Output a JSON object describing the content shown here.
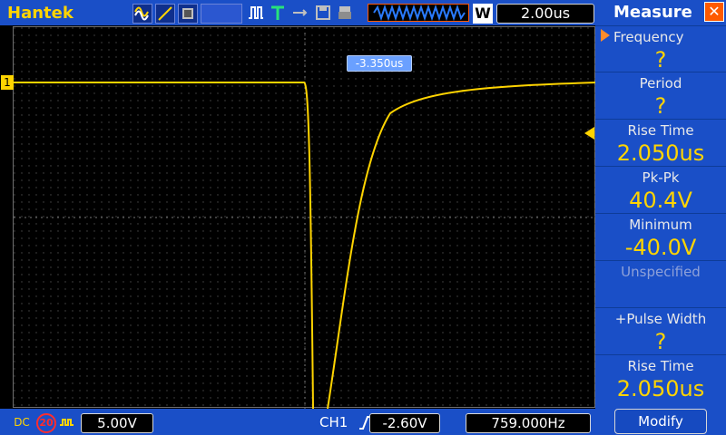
{
  "header": {
    "brand": "Hantek",
    "timebase": "2.00us",
    "zoom_label": "W",
    "trigger_offset": "-3.350us"
  },
  "footer": {
    "coupling": "DC",
    "bandwidth_limit": "20",
    "channel_scale": "5.00V",
    "trigger_channel": "CH1",
    "trigger_level": "-2.60V",
    "trigger_frequency": "759.000Hz"
  },
  "measure": {
    "title": "Measure",
    "items": [
      {
        "label": "Frequency",
        "value": "?"
      },
      {
        "label": "Period",
        "value": "?"
      },
      {
        "label": "Rise Time",
        "value": "2.050us"
      },
      {
        "label": "Pk-Pk",
        "value": "40.4V"
      },
      {
        "label": "Minimum",
        "value": "-40.0V"
      },
      {
        "label": "Unspecified",
        "value": ""
      },
      {
        "label": "+Pulse Width",
        "value": "?"
      },
      {
        "label": "Rise Time",
        "value": "2.050us"
      }
    ],
    "modify_label": "Modify"
  },
  "scope": {
    "channel_marker": "1",
    "trace_color": "#ffd400"
  }
}
